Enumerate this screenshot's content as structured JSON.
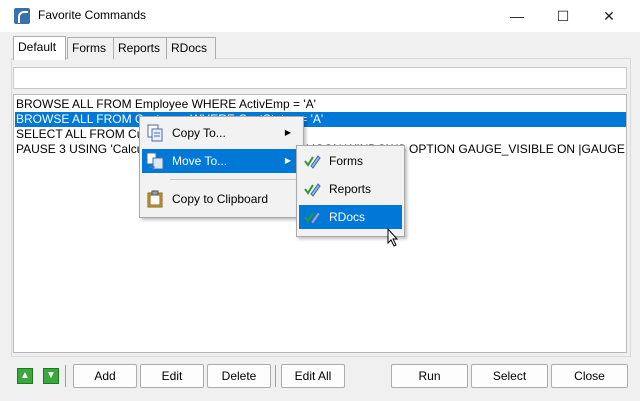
{
  "window": {
    "title": "Favorite Commands",
    "minimize_glyph": "—",
    "maximize_glyph": "☐",
    "close_glyph": "✕"
  },
  "tabs": [
    {
      "label": "Default",
      "active": true
    },
    {
      "label": "Forms",
      "active": false
    },
    {
      "label": "Reports",
      "active": false
    },
    {
      "label": "RDocs",
      "active": false
    }
  ],
  "commands": [
    "BROWSE ALL FROM Employee WHERE ActivEmp = 'A'",
    "BROWSE ALL FROM Customer WHERE CustStatus = 'A'",
    "SELECT ALL FROM Customer",
    "PAUSE 3 USING 'Calculating...' CAPTION 'Calculating' ICON WINDOWS  OPTION GAUGE_VISIBLE ON |GAUGE"
  ],
  "selected_command_index": 1,
  "context_menu": {
    "items": [
      {
        "label": "Copy To...",
        "icon": "copy-icon",
        "has_submenu": true
      },
      {
        "label": "Move To...",
        "icon": "move-icon",
        "has_submenu": true,
        "highlighted": true
      },
      {
        "label": "Copy to Clipboard",
        "icon": "clipboard-icon",
        "has_submenu": false
      }
    ],
    "submenu_arrow": "▶"
  },
  "submenu": {
    "items": [
      {
        "label": "Forms",
        "icon": "check-pencil-icon"
      },
      {
        "label": "Reports",
        "icon": "check-pencil-icon"
      },
      {
        "label": "RDocs",
        "icon": "check-pencil-icon",
        "highlighted": true
      }
    ]
  },
  "buttons": {
    "move_up": "▲",
    "move_down": "▼",
    "add": "Add",
    "edit": "Edit",
    "delete": "Delete",
    "edit_all": "Edit All",
    "run": "Run",
    "select": "Select",
    "close": "Close"
  },
  "colors": {
    "selection": "#0078d7",
    "window_bg": "#f0f0f0",
    "arrow_green": "#3aa83a"
  }
}
